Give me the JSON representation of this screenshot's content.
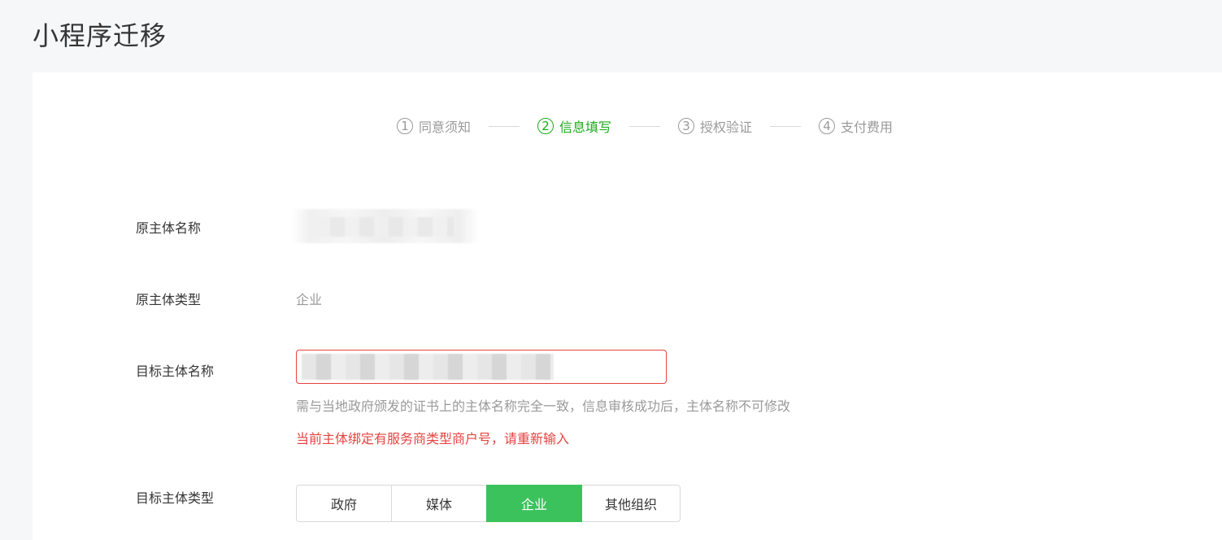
{
  "page": {
    "title": "小程序迁移"
  },
  "steps": [
    {
      "num": "1",
      "label": "同意须知",
      "active": false
    },
    {
      "num": "2",
      "label": "信息填写",
      "active": true
    },
    {
      "num": "3",
      "label": "授权验证",
      "active": false
    },
    {
      "num": "4",
      "label": "支付费用",
      "active": false
    }
  ],
  "form": {
    "original_name": {
      "label": "原主体名称",
      "value": ""
    },
    "original_type": {
      "label": "原主体类型",
      "value": "企业"
    },
    "target_name": {
      "label": "目标主体名称",
      "value": "",
      "placeholder": "",
      "hint": "需与当地政府颁发的证书上的主体名称完全一致，信息审核成功后，主体名称不可修改",
      "error": "当前主体绑定有服务商类型商户号，请重新输入"
    },
    "target_type": {
      "label": "目标主体类型",
      "options": [
        "政府",
        "媒体",
        "企业",
        "其他组织"
      ],
      "selected": "企业"
    }
  },
  "colors": {
    "accent_green": "#1aad19",
    "selected_green": "#3cc25d",
    "error_red": "#e64340",
    "muted_gray": "#9a9a9a"
  }
}
